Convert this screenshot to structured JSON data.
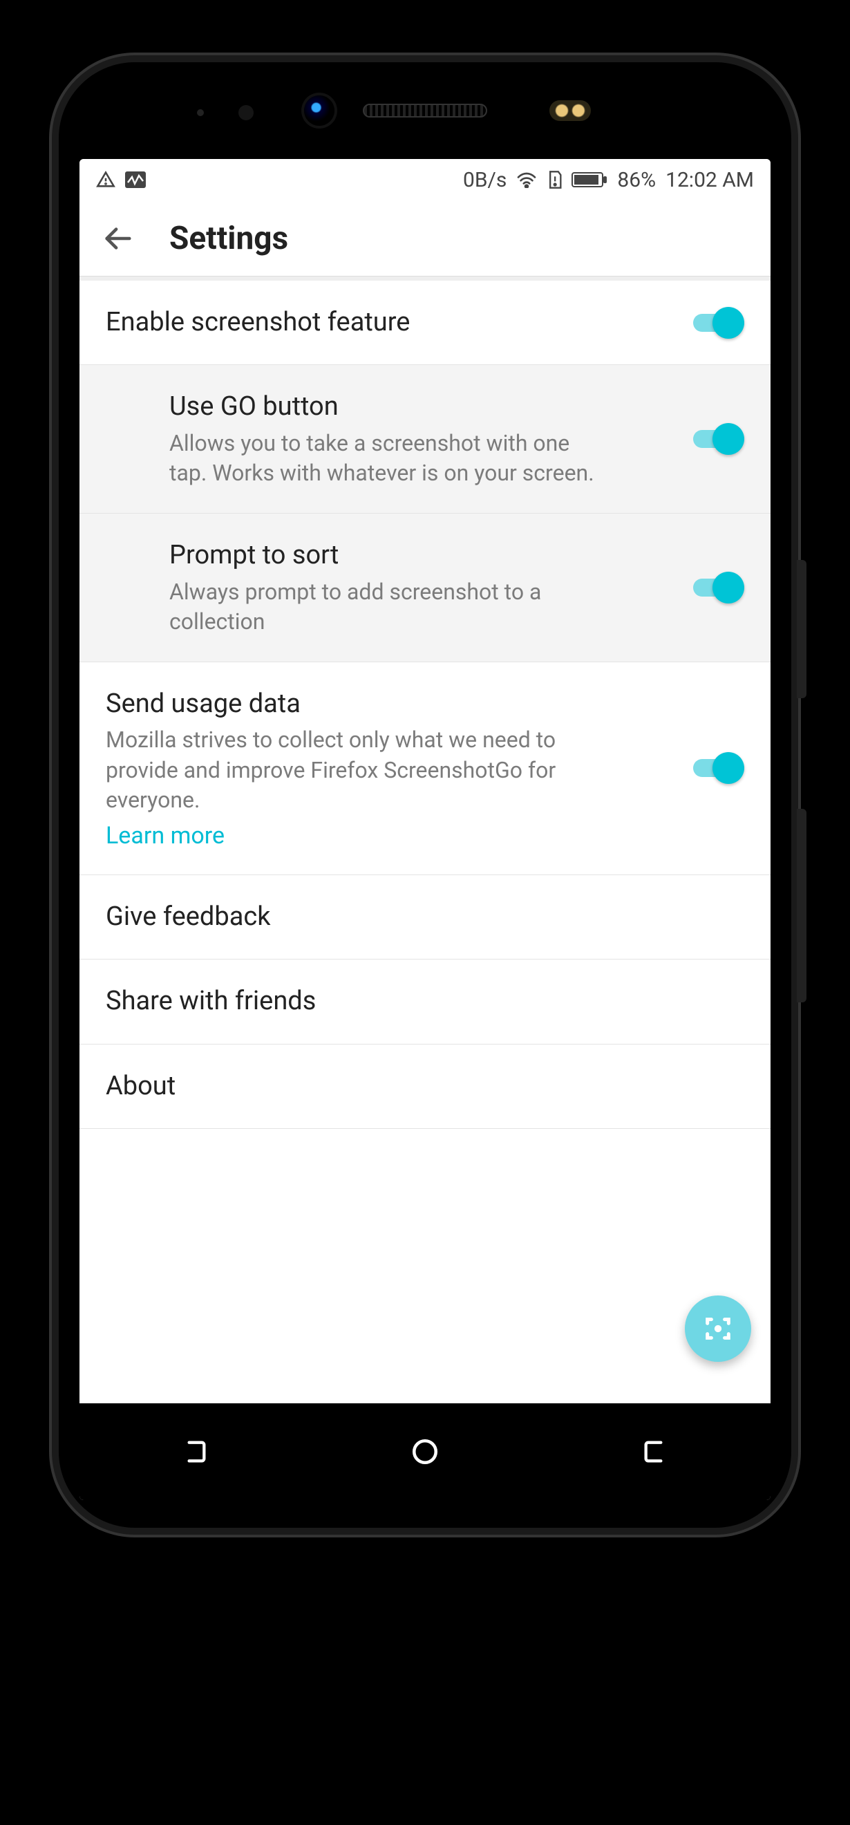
{
  "status": {
    "network_speed": "0B/s",
    "battery_pct": "86%",
    "time": "12:02 AM"
  },
  "appbar": {
    "title": "Settings"
  },
  "rows": {
    "enable": {
      "title": "Enable screenshot feature",
      "toggle": true
    },
    "go_button": {
      "title": "Use GO button",
      "desc": "Allows you to take a screenshot with one tap. Works with whatever is on your screen.",
      "toggle": true
    },
    "prompt_sort": {
      "title": "Prompt to sort",
      "desc": "Always prompt to add screenshot to a collection",
      "toggle": true
    },
    "usage_data": {
      "title": "Send usage data",
      "desc": "Mozilla strives to collect only what we need to provide and improve Firefox ScreenshotGo for everyone.",
      "link": "Learn more",
      "toggle": true
    },
    "feedback": {
      "title": "Give feedback"
    },
    "share": {
      "title": "Share with friends"
    },
    "about": {
      "title": "About"
    }
  }
}
